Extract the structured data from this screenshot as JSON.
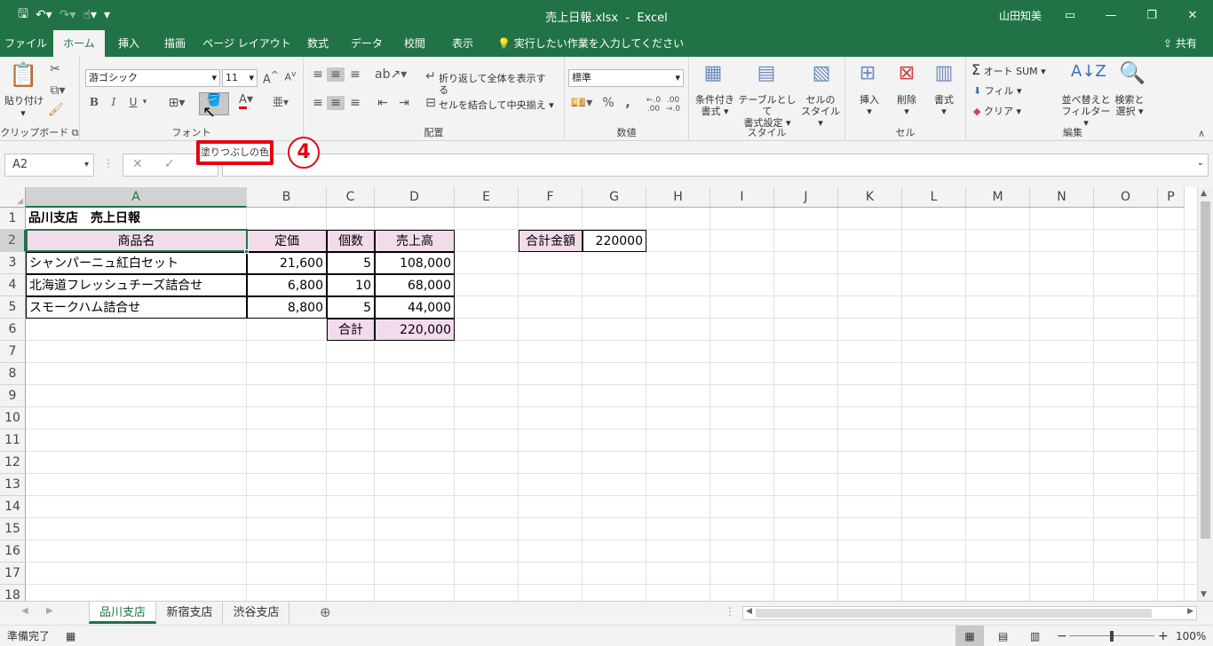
{
  "titlebar": {
    "filename": "売上日報.xlsx",
    "sep": "-",
    "app": "Excel",
    "user": "山田知美",
    "save_icon": "save-icon",
    "undo_icon": "undo-icon",
    "redo_icon": "redo-icon",
    "touch_icon": "touch-mode-icon",
    "customize_icon": "customize-qat-icon"
  },
  "tabs": [
    "ファイル",
    "ホーム",
    "挿入",
    "描画",
    "ページ レイアウト",
    "数式",
    "データ",
    "校閲",
    "表示"
  ],
  "tellme": "実行したい作業を入力してください",
  "share": "共有",
  "ribbon": {
    "clipboard": {
      "label": "クリップボード",
      "paste": "貼り付け"
    },
    "font": {
      "label": "フォント",
      "name": "游ゴシック",
      "size": "11",
      "bold": "B",
      "italic": "I",
      "underline": "U",
      "fontcolor": "A"
    },
    "alignment": {
      "label": "配置",
      "wrap": "折り返して全体を表示する",
      "merge": "セルを結合して中央揃え"
    },
    "number": {
      "label": "数値",
      "format": "標準",
      "percent": "%",
      "comma": ","
    },
    "styles": {
      "label": "スタイル",
      "cond": [
        "条件付き",
        "書式"
      ],
      "table": [
        "テーブルとして",
        "書式設定"
      ],
      "cellstyle": [
        "セルの",
        "スタイル"
      ]
    },
    "cells": {
      "label": "セル",
      "insert": "挿入",
      "delete": "削除",
      "format": "書式"
    },
    "editing": {
      "label": "編集",
      "autosum": "オート SUM",
      "fill": "フィル",
      "clear": "クリア",
      "sort": [
        "並べ替えと",
        "フィルター"
      ],
      "find": [
        "検索と",
        "選択"
      ]
    }
  },
  "formula": {
    "namebox": "A2",
    "cancel": "✕",
    "enter": "✓"
  },
  "tooltip": "塗りつぶしの色",
  "step": "4",
  "columns": [
    "A",
    "B",
    "C",
    "D",
    "E",
    "F",
    "G",
    "H",
    "I",
    "J",
    "K",
    "L",
    "M",
    "N",
    "O",
    "P"
  ],
  "rows": [
    "1",
    "2",
    "3",
    "4",
    "5",
    "6",
    "7",
    "8",
    "9",
    "10",
    "11",
    "12",
    "13",
    "14",
    "15",
    "16",
    "17",
    "18"
  ],
  "cells": {
    "A1": "品川支店　売上日報",
    "A2": "商品名",
    "B2": "定価",
    "C2": "個数",
    "D2": "売上高",
    "A3": "シャンパーニュ紅白セット",
    "B3": "21,600",
    "C3": "5",
    "D3": "108,000",
    "A4": "北海道フレッシュチーズ詰合せ",
    "B4": "6,800",
    "C4": "10",
    "D4": "68,000",
    "A5": "スモークハム詰合せ",
    "B5": "8,800",
    "C5": "5",
    "D5": "44,000",
    "C6": "合計",
    "D6": "220,000",
    "F2": "合計金額",
    "G2": "220000"
  },
  "sheets": [
    "品川支店",
    "新宿支店",
    "渋谷支店"
  ],
  "status": {
    "ready": "準備完了",
    "zoom": "100%"
  },
  "colors": {
    "excel_green": "#217346",
    "header_fill": "#f2dcec",
    "highlight_red": "#e60012"
  }
}
